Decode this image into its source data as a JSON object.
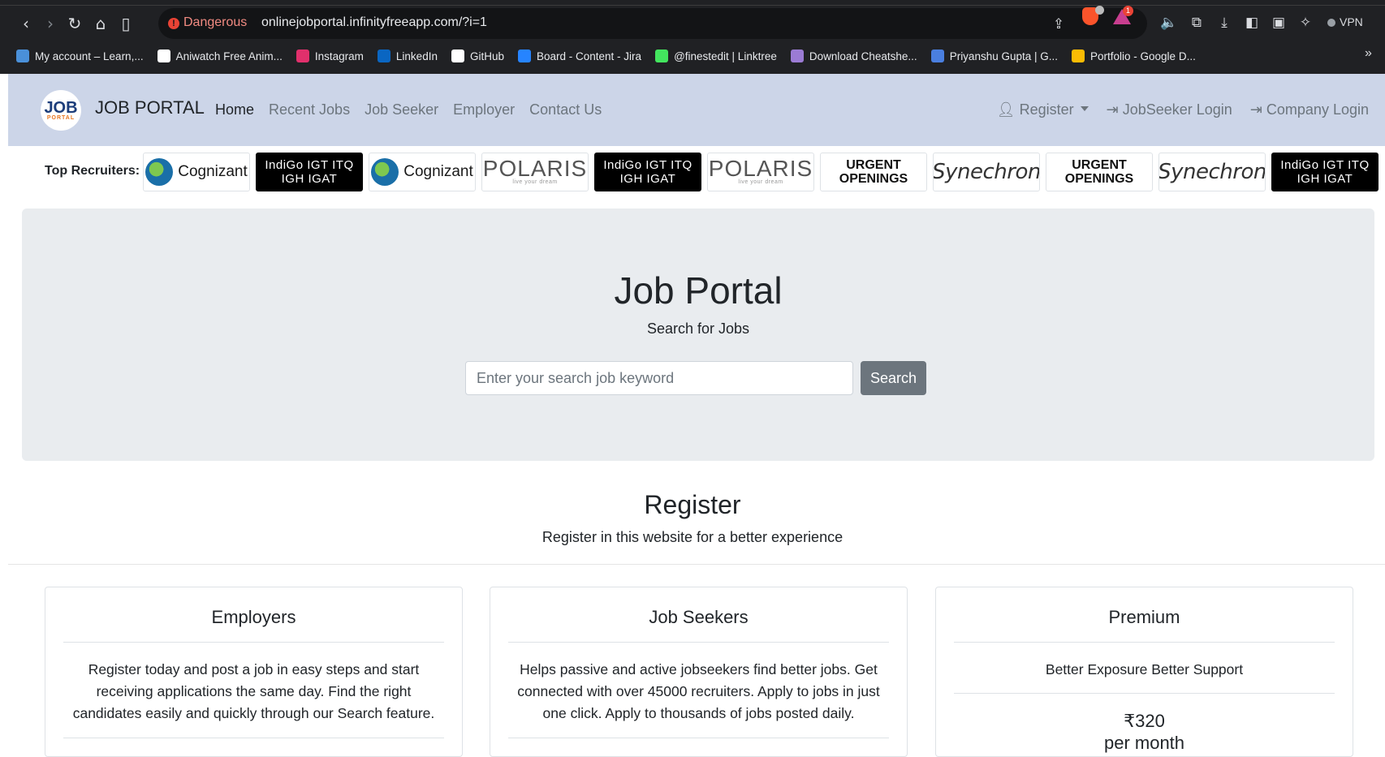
{
  "browser": {
    "security_label": "Dangerous",
    "url": "onlinejobportal.infinityfreeapp.com/?i=1",
    "notification_count": "1",
    "vpn_label": "VPN",
    "bookmarks": [
      {
        "label": "My account – Learn,...",
        "color": "#4a90d9"
      },
      {
        "label": "Aniwatch Free Anim...",
        "color": "#ffffff"
      },
      {
        "label": "Instagram",
        "color": "#e1306c"
      },
      {
        "label": "LinkedIn",
        "color": "#0a66c2"
      },
      {
        "label": "GitHub",
        "color": "#ffffff"
      },
      {
        "label": "Board - Content - Jira",
        "color": "#2684ff"
      },
      {
        "label": "@finestedit | Linktree",
        "color": "#43e55e"
      },
      {
        "label": "Download Cheatshe...",
        "color": "#9b7bd4"
      },
      {
        "label": "Priyanshu Gupta | G...",
        "color": "#4a7fe0"
      },
      {
        "label": "Portfolio - Google D...",
        "color": "#fbbc04"
      }
    ]
  },
  "navbar": {
    "logo_text": "JOB",
    "logo_subtext": "PORTAL",
    "brand": "JOB PORTAL",
    "links": [
      "Home",
      "Recent Jobs",
      "Job Seeker",
      "Employer",
      "Contact Us"
    ],
    "register_label": "Register",
    "jobseeker_login": "JobSeeker Login",
    "company_login": "Company Login"
  },
  "recruiters": {
    "label": "Top Recruiters:",
    "logos": [
      {
        "kind": "cognizant",
        "text": "Cognizant"
      },
      {
        "kind": "indigo",
        "text": "IndiGo IGT ITQ IGH IGAT"
      },
      {
        "kind": "cognizant",
        "text": "Cognizant"
      },
      {
        "kind": "polaris",
        "text": "POLARIS",
        "sub": "live your dream"
      },
      {
        "kind": "indigo",
        "text": "IndiGo IGT ITQ IGH IGAT"
      },
      {
        "kind": "polaris",
        "text": "POLARIS",
        "sub": "live your dream"
      },
      {
        "kind": "urgent",
        "text": "URGENT OPENINGS"
      },
      {
        "kind": "synechron",
        "text": "Synechron"
      },
      {
        "kind": "urgent",
        "text": "URGENT OPENINGS"
      },
      {
        "kind": "synechron",
        "text": "Synechron"
      },
      {
        "kind": "indigo",
        "text": "IndiGo IGT ITQ IGH IGAT"
      }
    ]
  },
  "hero": {
    "title": "Job Portal",
    "subtitle": "Search for Jobs",
    "search_placeholder": "Enter your search job keyword",
    "search_button": "Search"
  },
  "register": {
    "title": "Register",
    "subtitle": "Register in this website for a better experience",
    "cards": [
      {
        "title": "Employers",
        "text": "Register today and post a job in easy steps and start receiving applications the same day. Find the right candidates easily and quickly through our Search feature."
      },
      {
        "title": "Job Seekers",
        "text": "Helps passive and active jobseekers find better jobs. Get connected with over 45000 recruiters. Apply to jobs in just one click. Apply to thousands of jobs posted daily."
      },
      {
        "title": "Premium",
        "text": "Better Exposure Better Support",
        "price": "₹320",
        "price_period": "per month"
      }
    ]
  }
}
